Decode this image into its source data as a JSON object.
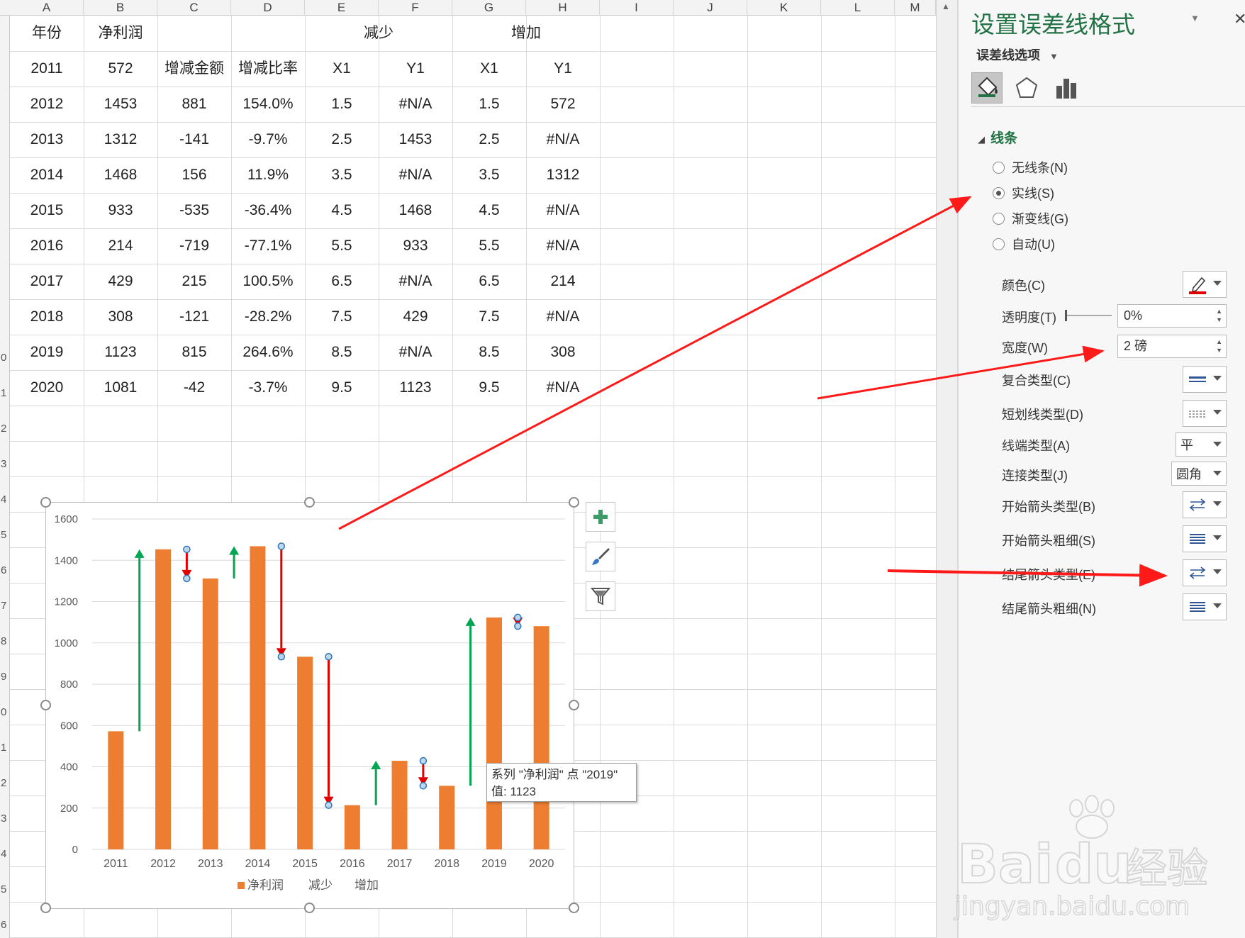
{
  "columns": [
    "A",
    "B",
    "C",
    "D",
    "E",
    "F",
    "G",
    "H",
    "I",
    "J",
    "K",
    "L",
    "M"
  ],
  "row_numbers": [
    "0",
    "1",
    "2",
    "3",
    "4",
    "5",
    "6",
    "7",
    "8",
    "9",
    "0",
    "1",
    "2",
    "3",
    "4",
    "5",
    "6"
  ],
  "table": {
    "header": {
      "year": "年份",
      "profit": "净利润",
      "decrease": "减少",
      "increase": "增加"
    },
    "subheader": {
      "year": "2011",
      "profit": "572",
      "change_amount": "增减金额",
      "change_rate": "增减比率",
      "dx": "X1",
      "dy": "Y1",
      "ix": "X1",
      "iy": "Y1"
    },
    "rows": [
      [
        "2012",
        "1453",
        "881",
        "154.0%",
        "1.5",
        "#N/A",
        "1.5",
        "572"
      ],
      [
        "2013",
        "1312",
        "-141",
        "-9.7%",
        "2.5",
        "1453",
        "2.5",
        "#N/A"
      ],
      [
        "2014",
        "1468",
        "156",
        "11.9%",
        "3.5",
        "#N/A",
        "3.5",
        "1312"
      ],
      [
        "2015",
        "933",
        "-535",
        "-36.4%",
        "4.5",
        "1468",
        "4.5",
        "#N/A"
      ],
      [
        "2016",
        "214",
        "-719",
        "-77.1%",
        "5.5",
        "933",
        "5.5",
        "#N/A"
      ],
      [
        "2017",
        "429",
        "215",
        "100.5%",
        "6.5",
        "#N/A",
        "6.5",
        "214"
      ],
      [
        "2018",
        "308",
        "-121",
        "-28.2%",
        "7.5",
        "429",
        "7.5",
        "#N/A"
      ],
      [
        "2019",
        "1123",
        "815",
        "264.6%",
        "8.5",
        "#N/A",
        "8.5",
        "308"
      ],
      [
        "2020",
        "1081",
        "-42",
        "-3.7%",
        "9.5",
        "1123",
        "9.5",
        "#N/A"
      ]
    ]
  },
  "chart_data": {
    "type": "bar",
    "categories": [
      "2011",
      "2012",
      "2013",
      "2014",
      "2015",
      "2016",
      "2017",
      "2018",
      "2019",
      "2020"
    ],
    "series": [
      {
        "name": "净利润",
        "values": [
          572,
          1453,
          1312,
          1468,
          933,
          214,
          429,
          308,
          1123,
          1081
        ],
        "color": "#ed7d31"
      }
    ],
    "error_bars": {
      "increase": {
        "name": "增加",
        "color": "#00a651",
        "x": [
          1.5,
          3.5,
          6.5,
          8.5
        ],
        "from": [
          572,
          1312,
          214,
          308
        ],
        "to": [
          1453,
          1468,
          429,
          1123
        ]
      },
      "decrease": {
        "name": "减少",
        "color": "#e00000",
        "x": [
          2.5,
          4.5,
          5.5,
          7.5,
          9.5
        ],
        "from": [
          1453,
          1468,
          933,
          429,
          1123
        ],
        "to": [
          1312,
          933,
          214,
          308,
          1081
        ]
      }
    },
    "yticks": [
      "0",
      "200",
      "400",
      "600",
      "800",
      "1000",
      "1200",
      "1400",
      "1600"
    ],
    "ylim": [
      0,
      1600
    ],
    "grid": true,
    "legend": [
      "净利润",
      "减少",
      "增加"
    ],
    "legend_position": "bottom"
  },
  "tooltip": {
    "line1": "系列 \"净利润\" 点 \"2019\"",
    "line2": "值: 1123"
  },
  "pane": {
    "title": "设置误差线格式",
    "options_label": "误差线选项",
    "section": "线条",
    "radios": [
      {
        "label": "无线条(N)",
        "checked": false
      },
      {
        "label": "实线(S)",
        "checked": true
      },
      {
        "label": "渐变线(G)",
        "checked": false
      },
      {
        "label": "自动(U)",
        "checked": false
      }
    ],
    "props": {
      "color": "颜色(C)",
      "transparency": "透明度(T)",
      "transparency_value": "0%",
      "width": "宽度(W)",
      "width_value": "2 磅",
      "compound": "复合类型(C)",
      "dash": "短划线类型(D)",
      "cap": "线端类型(A)",
      "cap_value": "平",
      "join": "连接类型(J)",
      "join_value": "圆角",
      "begin_arrow_type": "开始箭头类型(B)",
      "begin_arrow_size": "开始箭头粗细(S)",
      "end_arrow_type": "结尾箭头类型(E)",
      "end_arrow_size": "结尾箭头粗细(N)"
    },
    "accent_color": "#217346",
    "line_color_swatch": "#e00000"
  },
  "watermark": {
    "brand": "Bai",
    "brand2": "du",
    "cn": "经验",
    "url": "jingyan.baidu.com"
  }
}
